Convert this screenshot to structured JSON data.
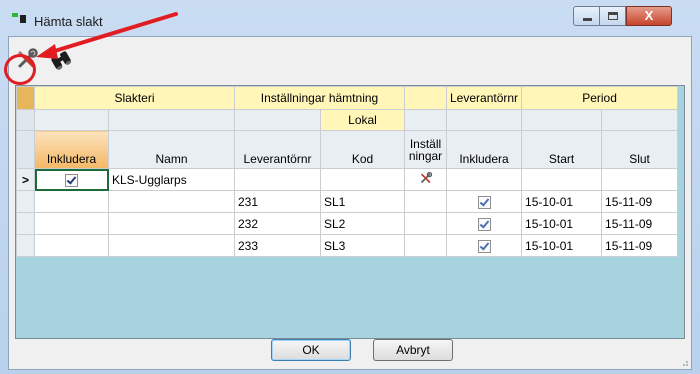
{
  "window": {
    "title": "Hämta slakt",
    "buttons": {
      "minimize": "minimize",
      "maximize": "maximize",
      "close": "X"
    }
  },
  "toolbar": {
    "icons": [
      "wrench-screwdriver-icon",
      "binoculars-icon"
    ]
  },
  "annotation": {
    "color": "#e21d22",
    "shapes": [
      "circle",
      "arrow"
    ]
  },
  "grid": {
    "group_headers": [
      "Slakteri",
      "Inställningar hämtning",
      "",
      "Leverantörnr",
      "Period"
    ],
    "sub_headers": {
      "lokal": "Lokal"
    },
    "columns": [
      "Inkludera",
      "Namn",
      "Leverantörnr",
      "Kod",
      "Inställ ningar",
      "Inkludera",
      "Start",
      "Slut"
    ],
    "current_row_marker": ">",
    "rows": [
      {
        "inkludera": true,
        "namn": "KLS-Ugglarps",
        "leverantornr": "",
        "kod": "",
        "installningar_icon": "wrench-screwdriver-icon",
        "inkludera2": null,
        "start": "",
        "slut": ""
      },
      {
        "inkludera": null,
        "namn": "",
        "leverantornr": "231",
        "kod": "SL1",
        "installningar_icon": "",
        "inkludera2": true,
        "start": "15-10-01",
        "slut": "15-11-09"
      },
      {
        "inkludera": null,
        "namn": "",
        "leverantornr": "232",
        "kod": "SL2",
        "installningar_icon": "",
        "inkludera2": true,
        "start": "15-10-01",
        "slut": "15-11-09"
      },
      {
        "inkludera": null,
        "namn": "",
        "leverantornr": "233",
        "kod": "SL3",
        "installningar_icon": "",
        "inkludera2": true,
        "start": "15-10-01",
        "slut": "15-11-09"
      }
    ]
  },
  "footer": {
    "ok_label": "OK",
    "cancel_label": "Avbryt"
  },
  "colors": {
    "header_yellow": "#fff6b8",
    "grid_background": "#a7d3df",
    "active_header": "#f4b765"
  }
}
